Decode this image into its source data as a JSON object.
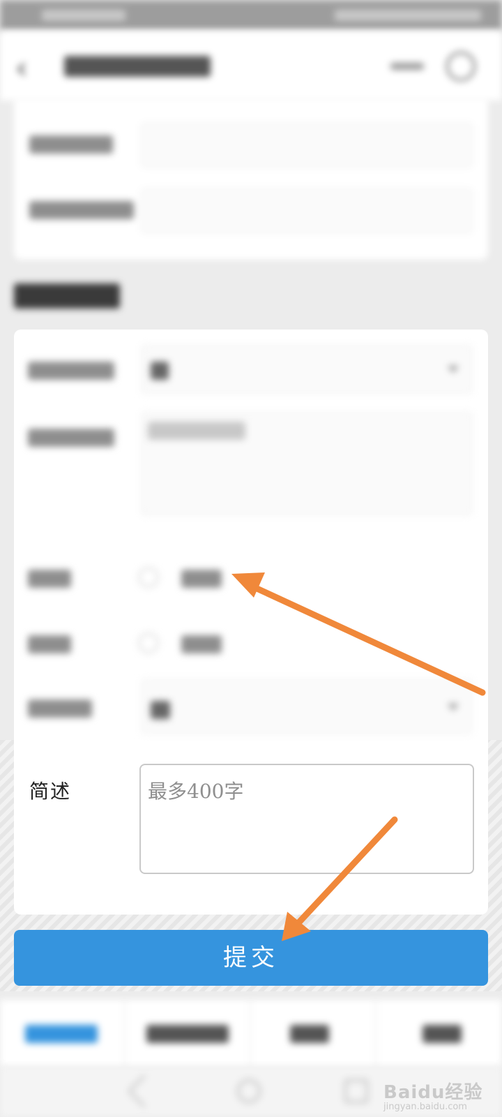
{
  "app": {
    "description_label": "简述",
    "description_placeholder": "最多400字",
    "submit_label": "提交"
  },
  "watermark": {
    "logo_text": "Baidu经验",
    "url_text": "jingyan.baidu.com"
  },
  "colors": {
    "accent": "#3594de",
    "arrow": "#f0883a"
  }
}
